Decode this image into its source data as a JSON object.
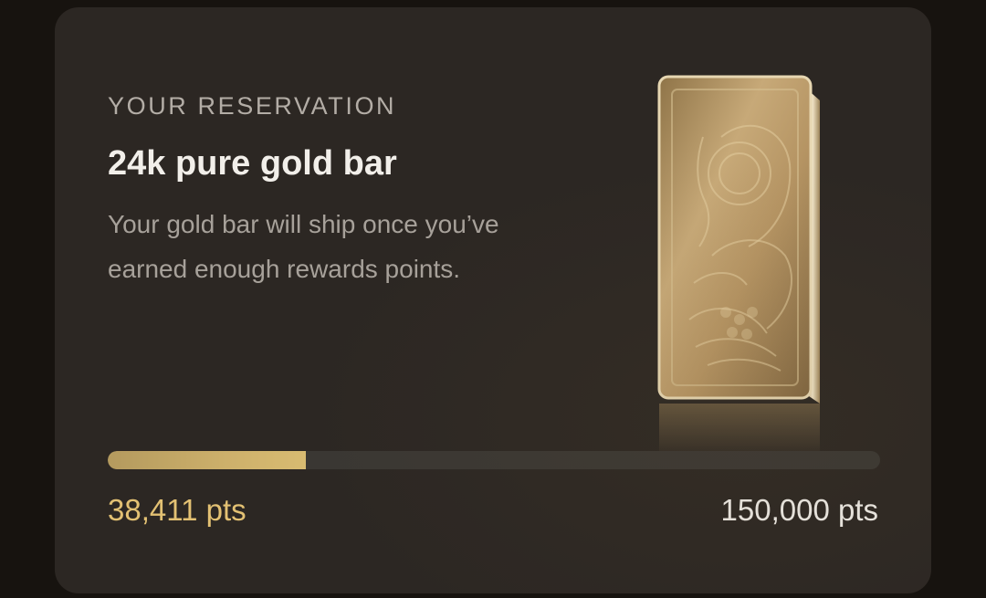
{
  "reservation": {
    "eyebrow": "YOUR RESERVATION",
    "title": "24k pure gold bar",
    "description": "Your gold bar will ship once you’ve earned enough rewards points."
  },
  "progress": {
    "current_label": "38,411 pts",
    "goal_label": "150,000 pts",
    "current": 38411,
    "goal": 150000,
    "fraction": 0.256
  },
  "image": {
    "icon": "gold-bar-image"
  },
  "colors": {
    "card_bg": "#2c2723",
    "page_bg": "#17130f",
    "gold_accent": "#e3c173",
    "progress_fill": "#cdb06b",
    "progress_track": "#3a3733"
  }
}
